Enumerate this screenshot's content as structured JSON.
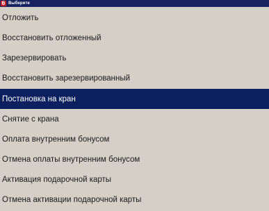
{
  "window": {
    "icon_glyph": "б",
    "title": "Выберите"
  },
  "colors": {
    "titlebar": "#16235f",
    "icon": "#c8201e",
    "selection": "#0c1f5e",
    "background": "#d4d0c8"
  },
  "menu": {
    "items": [
      {
        "label": "Отложить"
      },
      {
        "label": "Восстановить отложенный"
      },
      {
        "label": "Зарезервировать"
      },
      {
        "label": "Восстановить зарезервированный"
      },
      {
        "label": "Постановка на кран",
        "selected": true
      },
      {
        "label": "Снятие с крана"
      },
      {
        "label": "Оплата внутренним бонусом"
      },
      {
        "label": "Отмена оплаты внутренним бонусом"
      },
      {
        "label": "Активация подарочной карты"
      },
      {
        "label": "Отмена активации подарочной карты"
      }
    ]
  }
}
